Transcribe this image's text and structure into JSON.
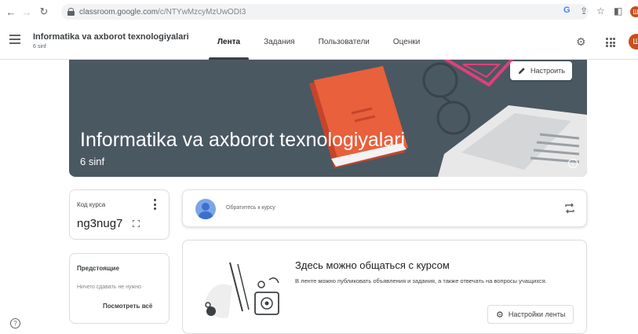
{
  "browser": {
    "url_host": "classroom.google.com",
    "url_path": "/c/NTYwMzcyMzUwODI3"
  },
  "header": {
    "course_title": "Informatika va axborot texnologiyalari",
    "course_section": "6 sinf",
    "tabs": [
      {
        "label": "Лента",
        "active": true
      },
      {
        "label": "Задания",
        "active": false
      },
      {
        "label": "Пользователи",
        "active": false
      },
      {
        "label": "Оценки",
        "active": false
      }
    ],
    "avatar_letter": "Ш"
  },
  "banner": {
    "title": "Informatika va axborot texnologiyalari",
    "section": "6 sinf",
    "customize_label": "Настроить",
    "info_glyph": "i"
  },
  "class_code": {
    "label": "Код курса",
    "value": "ng3nug7"
  },
  "upcoming": {
    "title": "Предстоящие",
    "empty_text": "Ничего сдавать не нужно",
    "view_all": "Посмотреть всё"
  },
  "announce": {
    "placeholder": "Обратитесь к курсу"
  },
  "stream": {
    "title": "Здесь можно общаться с курсом",
    "description": "В ленте можно публиковать объявления и задания, а также отвечать на вопросы учащихся.",
    "settings_label": "Настройки ленты"
  },
  "help_glyph": "?",
  "colors": {
    "banner": "#4a5862",
    "book": "#e8603c",
    "glasses": "#e0407a",
    "avatar": "#c5501f",
    "announce_avatar": "#3d6fcf"
  }
}
